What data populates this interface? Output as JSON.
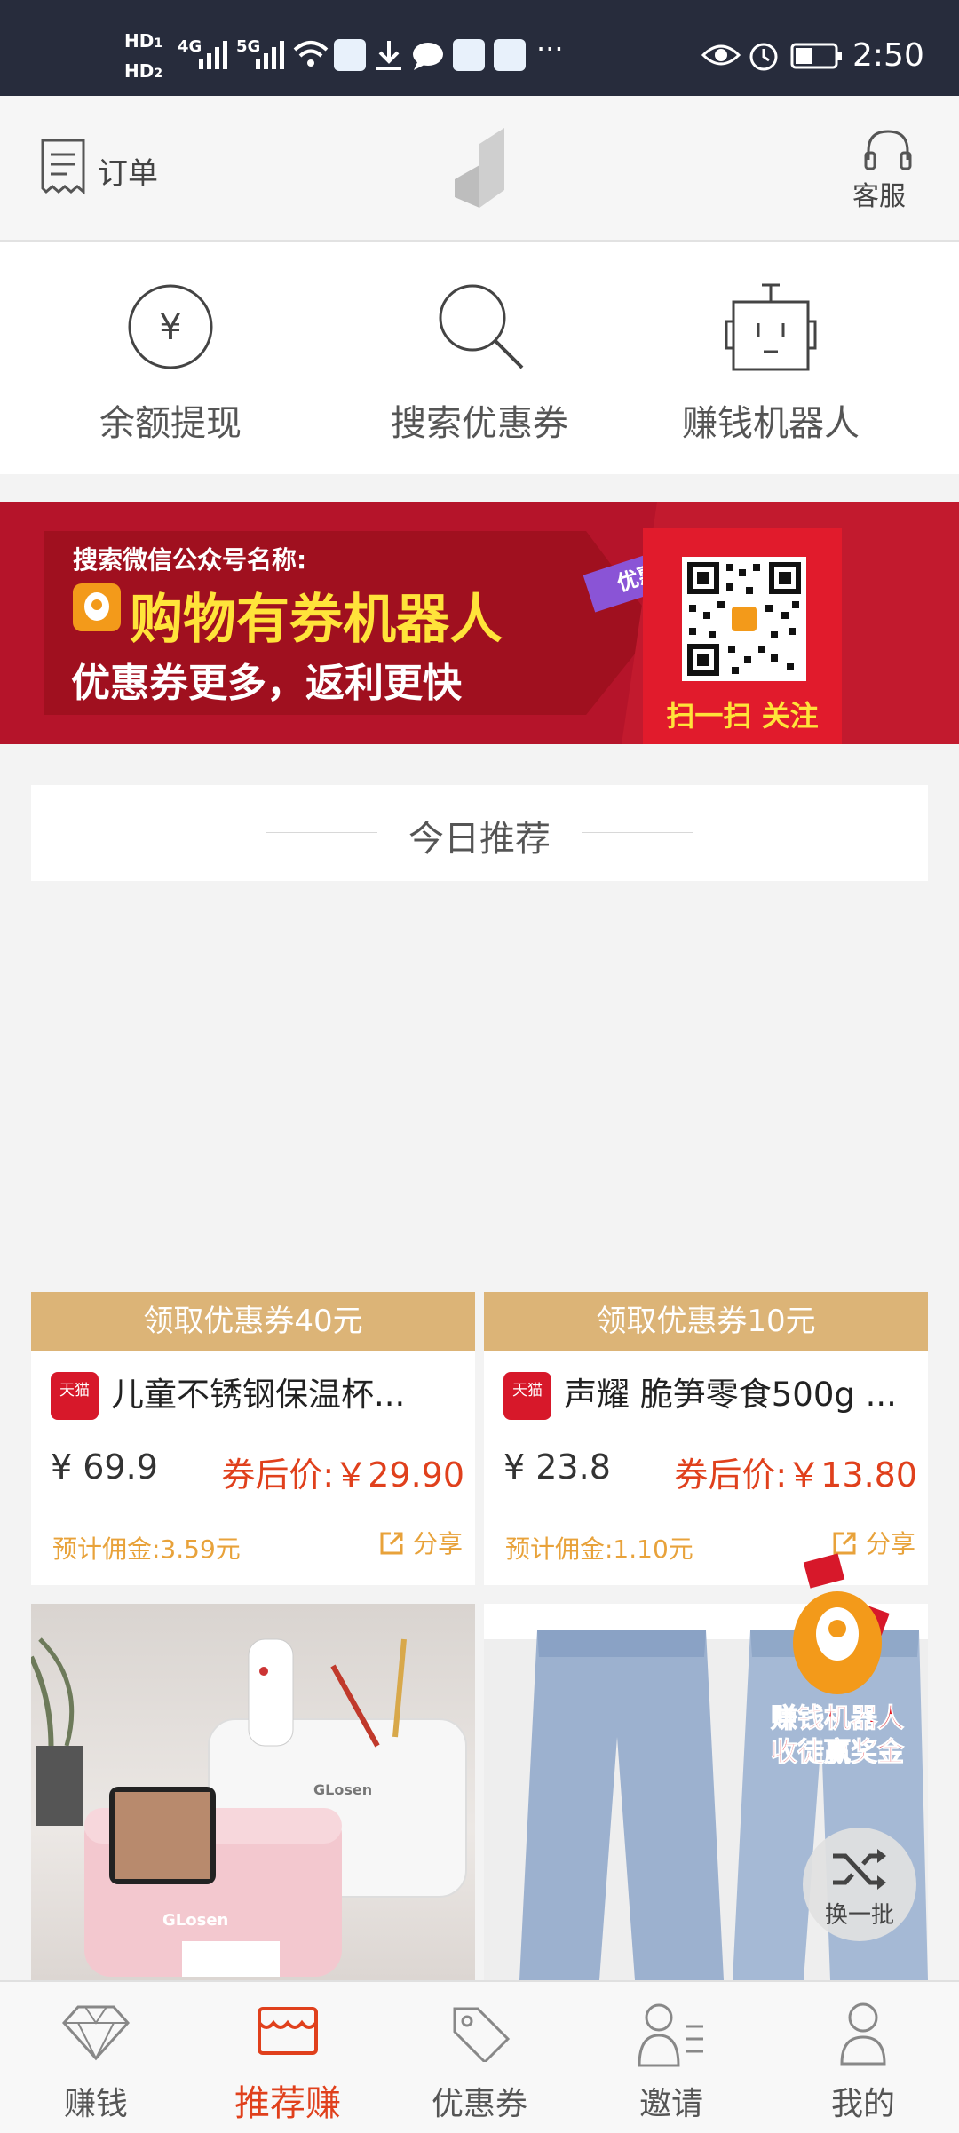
{
  "status_bar": {
    "time": "2:50",
    "hd1": "HD",
    "hd2": "HD",
    "sim1_net": "4G",
    "sim2_net": "5G",
    "sim1_index": "1",
    "sim2_index": "2",
    "more": "···"
  },
  "header": {
    "orders_label": "订单",
    "service_label": "客服"
  },
  "quick_actions": [
    {
      "label": "余额提现",
      "icon": "yuan-circle-icon"
    },
    {
      "label": "搜索优惠券",
      "icon": "search-icon"
    },
    {
      "label": "赚钱机器人",
      "icon": "robot-icon"
    }
  ],
  "banner": {
    "line1": "搜索微信公众号名称:",
    "line2": "购物有券机器人",
    "line3": "优惠券更多，返利更快",
    "tag": "优惠券",
    "scan": "扫一扫 关注"
  },
  "section": {
    "today_title": "今日推荐"
  },
  "products": [
    {
      "coupon": "领取优惠券40元",
      "platform": "天猫",
      "title": "儿童不锈钢保温杯...",
      "price": "¥ 69.9",
      "after_price": "券后价:￥29.90",
      "commission": "预计佣金:3.59元",
      "share": "分享"
    },
    {
      "coupon": "领取优惠券10元",
      "platform": "天猫",
      "title": "声耀 脆笋零食500g ...",
      "price": "¥ 23.8",
      "after_price": "券后价:￥13.80",
      "commission": "预计佣金:1.10元",
      "share": "分享"
    }
  ],
  "product_images": [
    {
      "brand1": "GLosen",
      "brand2": "GLosen"
    },
    {}
  ],
  "floating": {
    "promo_line1": "赚钱机器人",
    "promo_line2": "收徒赢奖金",
    "shuffle_label": "换一批"
  },
  "tab_bar": [
    {
      "label": "赚钱",
      "icon": "diamond-icon",
      "active": false
    },
    {
      "label": "推荐赚",
      "icon": "store-icon",
      "active": true
    },
    {
      "label": "优惠券",
      "icon": "tag-icon",
      "active": false
    },
    {
      "label": "邀请",
      "icon": "invite-user-icon",
      "active": false
    },
    {
      "label": "我的",
      "icon": "person-icon",
      "active": false
    }
  ],
  "colors": {
    "accent": "#e0401c",
    "coupon_bar": "#dcb477",
    "banner_red": "#b5142a",
    "status_bar": "#272c3c"
  }
}
